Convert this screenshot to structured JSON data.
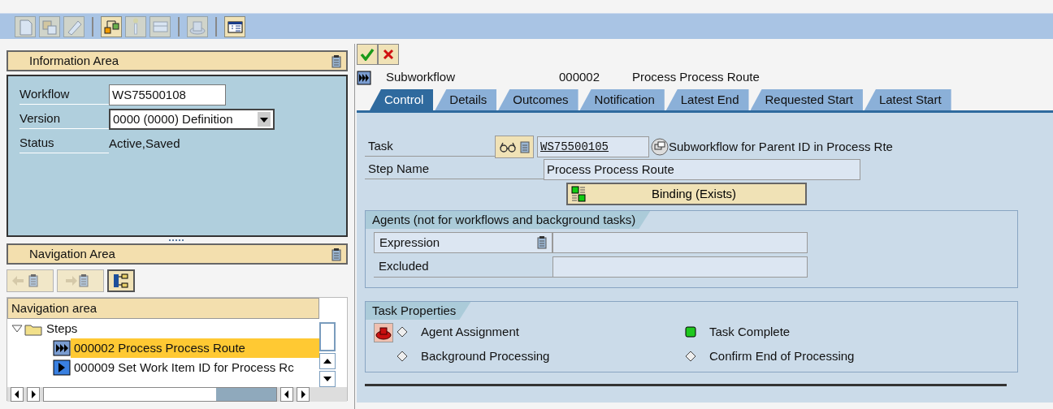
{
  "toolbar": {
    "buttons": [
      {
        "kind": "new",
        "disabled": true
      },
      {
        "kind": "copy",
        "disabled": true
      },
      {
        "kind": "edit",
        "disabled": true
      },
      {
        "kind": "graph",
        "disabled": false
      },
      {
        "kind": "light",
        "disabled": true
      },
      {
        "kind": "bus",
        "disabled": true
      },
      {
        "kind": "hat",
        "disabled": true
      },
      {
        "kind": "layout",
        "disabled": false
      }
    ]
  },
  "information_area": {
    "title": "Information Area",
    "fields": [
      {
        "kind": "input",
        "label": "Workflow",
        "value": "WS75500108"
      },
      {
        "kind": "dropdown",
        "label": "Version",
        "value": "0000 (0000) Definition"
      },
      {
        "kind": "text",
        "label": "Status",
        "value": "Active,Saved"
      }
    ]
  },
  "navigation_area": {
    "title": "Navigation Area",
    "column": "Navigation area",
    "tree": [
      {
        "label": "Steps",
        "expanded": true,
        "children": [
          {
            "label": "000002 Process Process Route",
            "kind": "subworkflow",
            "selected": true
          },
          {
            "label": "000009 Set Work Item ID for Process Rc",
            "kind": "activity",
            "selected": false
          }
        ]
      }
    ]
  },
  "step_header": {
    "type": "Subworkflow",
    "number": "000002",
    "name": "Process Process Route"
  },
  "tabs": [
    {
      "label": "Control",
      "selected": true
    },
    {
      "label": "Details",
      "selected": false
    },
    {
      "label": "Outcomes",
      "selected": false
    },
    {
      "label": "Notification",
      "selected": false
    },
    {
      "label": "Latest End",
      "selected": false
    },
    {
      "label": "Requested Start",
      "selected": false
    },
    {
      "label": "Latest Start",
      "selected": false
    }
  ],
  "control": {
    "task_label": "Task",
    "task_value": "WS75500105",
    "task_description": "Subworkflow for Parent ID in Process Rte",
    "step_name_label": "Step Name",
    "step_name_value": "Process Process Route",
    "binding_button": "Binding (Exists)",
    "agents": {
      "title": "Agents (not for workflows and background tasks)",
      "fields": [
        {
          "label": "Expression",
          "has_menu": true
        },
        {
          "label": "Excluded",
          "has_menu": false
        }
      ]
    },
    "task_properties": {
      "title": "Task Properties",
      "items": [
        {
          "label": "Agent Assignment",
          "kind": "diamond"
        },
        {
          "label": "Task Complete",
          "kind": "square"
        },
        {
          "label": "Background Processing",
          "kind": "diamond"
        },
        {
          "label": "Confirm End of Processing",
          "kind": "diamond"
        }
      ]
    }
  }
}
